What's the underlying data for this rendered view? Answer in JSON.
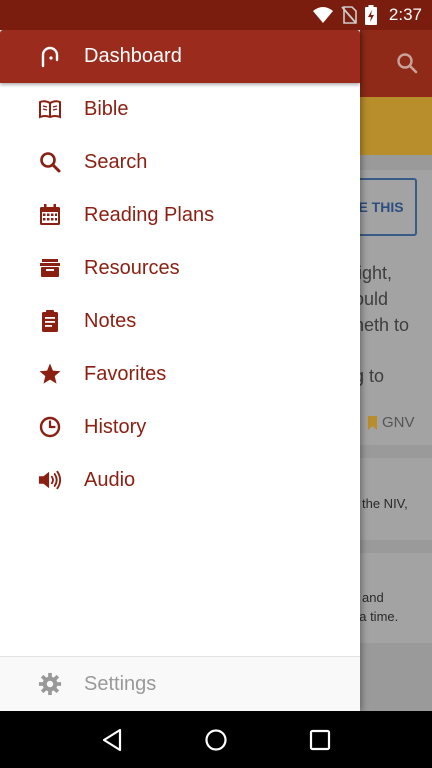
{
  "status_bar": {
    "time": "2:37"
  },
  "background": {
    "verse_button_label": "E THIS",
    "verse_lines": [
      "light,",
      "ould",
      "neth to",
      "",
      "g to"
    ],
    "version_label": "GNV",
    "card2_text": "the NIV,",
    "card3_lines": [
      "and",
      "t a time."
    ]
  },
  "drawer": {
    "items": [
      {
        "label": "Dashboard",
        "icon": "dashboard-icon",
        "active": true
      },
      {
        "label": "Bible",
        "icon": "open-book-icon"
      },
      {
        "label": "Search",
        "icon": "search-icon"
      },
      {
        "label": "Reading Plans",
        "icon": "calendar-icon"
      },
      {
        "label": "Resources",
        "icon": "archive-box-icon"
      },
      {
        "label": "Notes",
        "icon": "clipboard-notes-icon"
      },
      {
        "label": "Favorites",
        "icon": "star-icon"
      },
      {
        "label": "History",
        "icon": "clock-icon"
      },
      {
        "label": "Audio",
        "icon": "speaker-icon"
      }
    ],
    "footer": {
      "label": "Settings",
      "icon": "gear-icon"
    }
  },
  "colors": {
    "accent": "#8b1f12",
    "active_bg": "#9b2c1d",
    "status_bar": "#7a1d0f"
  }
}
